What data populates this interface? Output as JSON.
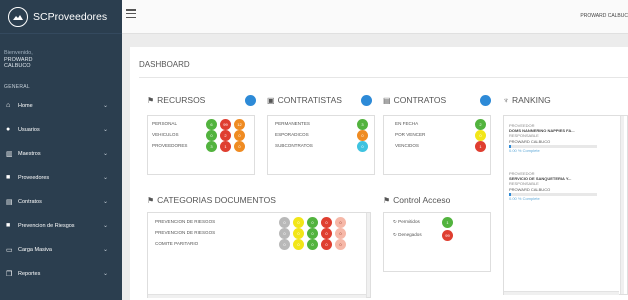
{
  "app": {
    "brand": "SCProveedores"
  },
  "user": {
    "welcome_label": "Bienvenido,",
    "name": "PROWARD CALBUCO",
    "top_name": "PROWARD CALBUC"
  },
  "sidebar": {
    "section": "GENERAL",
    "items": [
      {
        "label": "Home",
        "icon": "home-icon"
      },
      {
        "label": "Usuarios",
        "icon": "users-icon"
      },
      {
        "label": "Maestros",
        "icon": "chart-icon"
      },
      {
        "label": "Proveedores",
        "icon": "truck-icon"
      },
      {
        "label": "Contratos",
        "icon": "document-icon"
      },
      {
        "label": "Prevencion de Riesgos",
        "icon": "truck-icon"
      },
      {
        "label": "Carga Masiva",
        "icon": "desktop-icon"
      },
      {
        "label": "Reportes",
        "icon": "copy-icon"
      }
    ]
  },
  "dashboard": {
    "title": "DASHBOARD",
    "recursos": {
      "title": "RECURSOS",
      "badge": "",
      "rows": [
        {
          "label": "PERSONAL",
          "dots": [
            {
              "color": "green",
              "value": "6"
            },
            {
              "color": "red",
              "value": "99"
            },
            {
              "color": "orange",
              "value": "12"
            }
          ]
        },
        {
          "label": "VEHICULOS",
          "dots": [
            {
              "color": "green",
              "value": "0"
            },
            {
              "color": "red",
              "value": "2"
            },
            {
              "color": "orange",
              "value": "0"
            }
          ]
        },
        {
          "label": "PROVEEDORES",
          "dots": [
            {
              "color": "green",
              "value": "3"
            },
            {
              "color": "red",
              "value": "1"
            },
            {
              "color": "orange",
              "value": "0"
            }
          ]
        }
      ]
    },
    "contratistas": {
      "title": "CONTRATISTAS",
      "rows": [
        {
          "label": "PERMANENTES",
          "color": "green",
          "value": "3"
        },
        {
          "label": "ESPORADICOS",
          "color": "orange",
          "value": "0"
        },
        {
          "label": "SUBCONTRATOS",
          "color": "blue",
          "value": "0"
        }
      ]
    },
    "contratos": {
      "title": "CONTRATOS",
      "rows": [
        {
          "label": "EN FECHA",
          "color": "green",
          "value": "2"
        },
        {
          "label": "POR VENCER",
          "color": "yellow",
          "value": "0"
        },
        {
          "label": "VENCIDOS",
          "color": "red",
          "value": "1"
        }
      ]
    },
    "ranking": {
      "title": "RANKING",
      "items": [
        {
          "prov_label": "PROVEEDOR",
          "prov_name": "DOMS NANNERINO NAPPIES FA...",
          "resp_label": "RESPONSABLE",
          "resp_name": "PROWARD CALBUCO",
          "progress": 0.02,
          "pct_text": "0.00 % Complete"
        },
        {
          "prov_label": "PROVEEDOR",
          "prov_name": "SERVICIO DE SANQUETERIA Y...",
          "resp_label": "RESPONSABLE",
          "resp_name": "PROWARD CALBUCO",
          "progress": 0.02,
          "pct_text": "0.00 % Complete"
        }
      ]
    },
    "categorias": {
      "title": "CATEGORIAS DOCUMENTOS",
      "rows": [
        {
          "label": "PREVENCION DE RIESGOS",
          "dots": [
            {
              "color": "grey",
              "value": "0"
            },
            {
              "color": "yellow",
              "value": "0"
            },
            {
              "color": "green",
              "value": "0"
            },
            {
              "color": "red",
              "value": "0"
            },
            {
              "color": "pink",
              "value": "0"
            }
          ]
        },
        {
          "label": "PREVENCION DE RIESGOS",
          "dots": [
            {
              "color": "grey",
              "value": "0"
            },
            {
              "color": "yellow",
              "value": "0"
            },
            {
              "color": "green",
              "value": "0"
            },
            {
              "color": "red",
              "value": "0"
            },
            {
              "color": "pink",
              "value": "0"
            }
          ]
        },
        {
          "label": "COMITE PARITARIO",
          "dots": [
            {
              "color": "grey",
              "value": "0"
            },
            {
              "color": "yellow",
              "value": "0"
            },
            {
              "color": "green",
              "value": "0"
            },
            {
              "color": "red",
              "value": "0"
            },
            {
              "color": "pink",
              "value": "0"
            }
          ]
        }
      ]
    },
    "acceso": {
      "title": "Control Acceso",
      "rows": [
        {
          "label": "Permitidos",
          "icon": "refresh-icon",
          "color": "green",
          "value": "1"
        },
        {
          "label": "Denegados",
          "icon": "refresh-icon",
          "color": "red",
          "value": "99"
        }
      ]
    }
  }
}
